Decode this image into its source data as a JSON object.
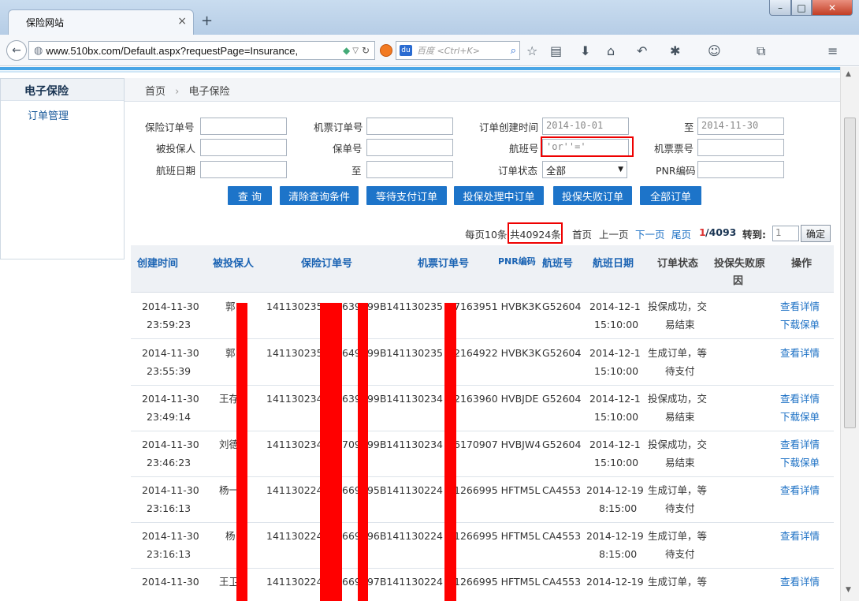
{
  "browser": {
    "tab_title": "保险网站",
    "new_tab": "+",
    "tab_close": "×",
    "url": "www.510bx.com/Default.aspx?requestPage=Insurance,",
    "search_placeholder": "百度 <Ctrl+K>",
    "baidu_logo": "du"
  },
  "sidebar": {
    "title": "电子保险",
    "items": [
      {
        "label": "订单管理"
      }
    ]
  },
  "breadcrumb": {
    "home": "首页",
    "sep": "›",
    "current": "电子保险"
  },
  "form": {
    "insurance_order_no": {
      "label": "保险订单号",
      "value": ""
    },
    "ticket_order_no": {
      "label": "机票订单号",
      "value": ""
    },
    "order_created": {
      "label": "订单创建时间",
      "value": "2014-10-01"
    },
    "to_label": "至",
    "order_created_end": {
      "value": "2014-11-30"
    },
    "insured": {
      "label": "被投保人",
      "value": ""
    },
    "policy_no": {
      "label": "保单号",
      "value": ""
    },
    "flight_no": {
      "label": "航班号",
      "value": "'or''='"
    },
    "ticket_no": {
      "label": "机票票号",
      "value": ""
    },
    "flight_date": {
      "label": "航班日期",
      "value": ""
    },
    "flight_date_to": {
      "label": "至",
      "value": ""
    },
    "order_status": {
      "label": "订单状态",
      "value": "全部"
    },
    "pnr": {
      "label": "PNR编码",
      "value": ""
    }
  },
  "buttons": {
    "query": "查 询",
    "clear": "清除查询条件",
    "pending_payment": "等待支付订单",
    "processing": "投保处理中订单",
    "failed": "投保失败订单",
    "all": "全部订单"
  },
  "pager": {
    "per_page": "每页10条",
    "total": "共40924条",
    "first": "首页",
    "prev": "上一页",
    "next": "下一页",
    "last": "尾页",
    "current": "1",
    "total_pages": "/4093",
    "goto_label": "转到:",
    "goto_value": "1",
    "confirm": "确定"
  },
  "table": {
    "headers": {
      "created": "创建时间",
      "insured": "被投保人",
      "insurance_no": "保险订单号",
      "ticket_no": "机票订单号",
      "pnr": "PNR编码",
      "flight": "航班号",
      "date": "航班日期",
      "status": "订单状态",
      "fail_reason_1": "投保失败原",
      "fail_reason_2": "因",
      "action": "操作"
    },
    "rows": [
      {
        "date": "2014-11-30",
        "time": "23:59:23",
        "insured": "郭",
        "ins_no": "1411302359",
        "ins_mid": "639",
        "ticket": "999B141130235",
        "pnr_tail": "7163951 HVBK3K",
        "flight": "G52604",
        "fdate": "2014-12-1",
        "ftime": "15:10:00",
        "status1": "投保成功，交",
        "status2": "易结束",
        "detail": "查看详情",
        "download": "下载保单"
      },
      {
        "date": "2014-11-30",
        "time": "23:55:39",
        "insured": "郭",
        "ins_no": "1411302354",
        "ins_mid": "649",
        "ticket": "999B141130235",
        "pnr_tail": "2164922 HVBK3K",
        "flight": "G52604",
        "fdate": "2014-12-1",
        "ftime": "15:10:00",
        "status1": "生成订单，等",
        "status2": "待支付",
        "detail": "查看详情",
        "download": ""
      },
      {
        "date": "2014-11-30",
        "time": "23:49:14",
        "insured": "王存",
        "ins_no": "1411302348",
        "ins_mid": "639",
        "ticket": "999B141130234",
        "pnr_tail": "2163960 HVBJDE",
        "flight": "G52604",
        "fdate": "2014-12-1",
        "ftime": "15:10:00",
        "status1": "投保成功，交",
        "status2": "易结束",
        "detail": "查看详情",
        "download": "下载保单"
      },
      {
        "date": "2014-11-30",
        "time": "23:46:23",
        "insured": "刘德",
        "ins_no": "1411302345",
        "ins_mid": "709",
        "ticket": "999B141130234",
        "pnr_tail": "6170907 HVBJW4",
        "flight": "G52604",
        "fdate": "2014-12-1",
        "ftime": "15:10:00",
        "status1": "投保成功，交",
        "status2": "易结束",
        "detail": "查看详情",
        "download": "下载保单"
      },
      {
        "date": "2014-11-30",
        "time": "23:16:13",
        "insured": "杨一",
        "ins_no": "1411302246",
        "ins_mid": "669",
        "ticket": "995B141130224",
        "pnr_tail": "1266995 HFTM5L",
        "flight": "CA4553",
        "fdate": "2014-12-19",
        "ftime": "8:15:00",
        "status1": "生成订单，等",
        "status2": "待支付",
        "detail": "查看详情",
        "download": ""
      },
      {
        "date": "2014-11-30",
        "time": "23:16:13",
        "insured": "杨",
        "ins_no": "1411302246",
        "ins_mid": "669",
        "ticket": "996B141130224",
        "pnr_tail": "1266995 HFTM5L",
        "flight": "CA4553",
        "fdate": "2014-12-19",
        "ftime": "8:15:00",
        "status1": "生成订单，等",
        "status2": "待支付",
        "detail": "查看详情",
        "download": ""
      },
      {
        "date": "2014-11-30",
        "time": "",
        "insured": "王卫",
        "ins_no": "1411302246",
        "ins_mid": "669",
        "ticket": "997B141130224",
        "pnr_tail": "1266995 HFTM5L",
        "flight": "CA4553",
        "fdate": "2014-12-19",
        "ftime": "",
        "status1": "生成订单，等",
        "status2": "",
        "detail": "查看详情",
        "download": ""
      }
    ]
  }
}
